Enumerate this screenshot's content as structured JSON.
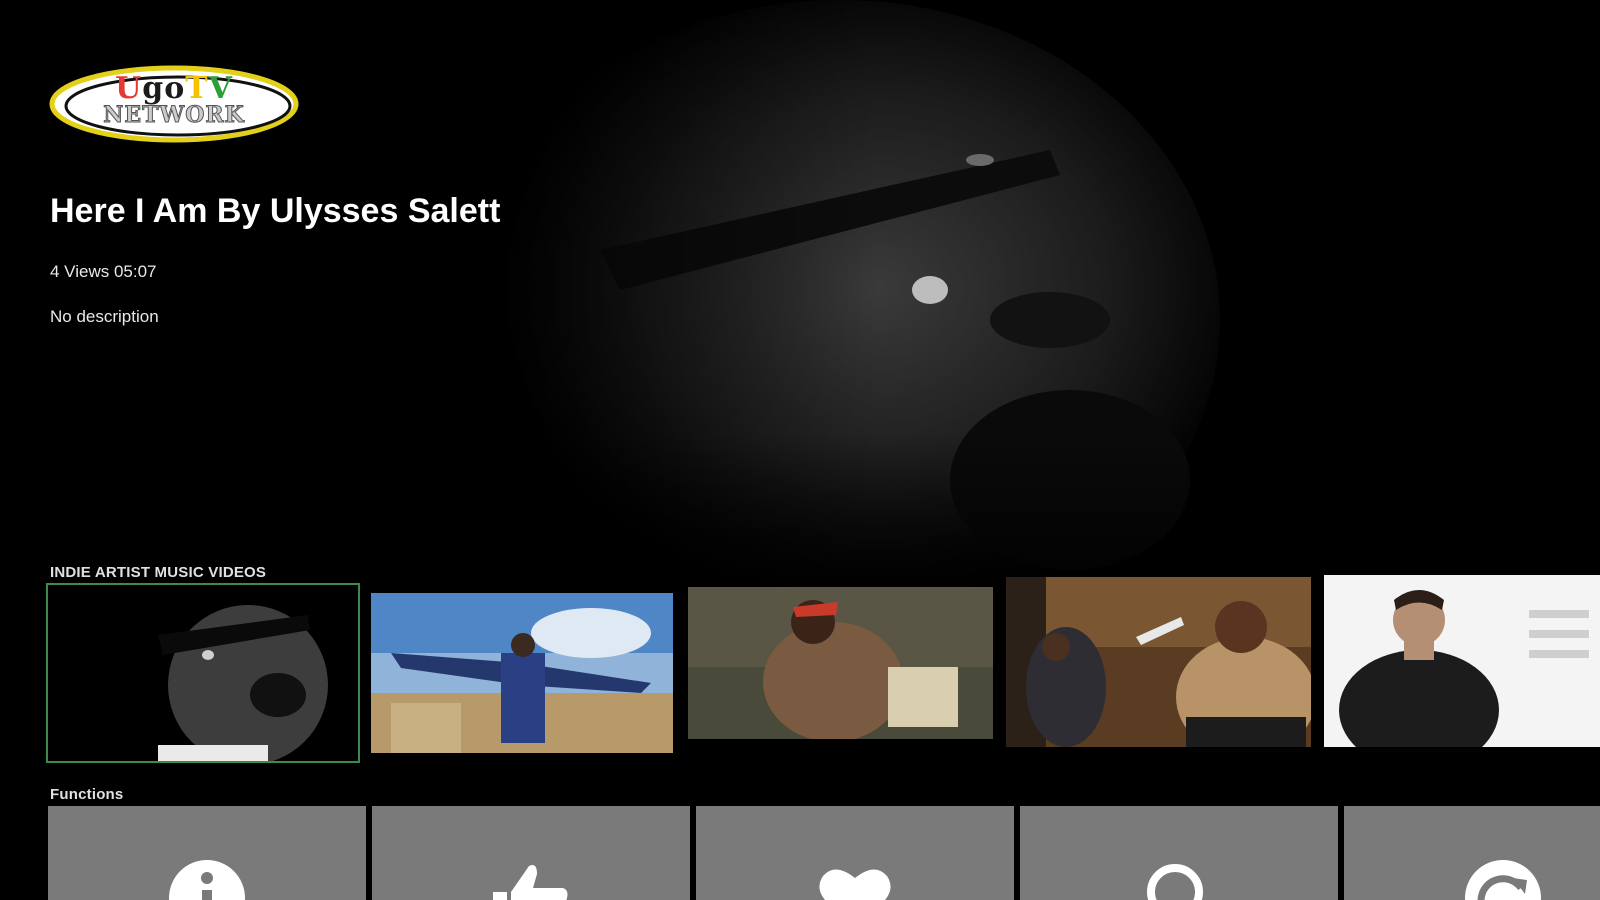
{
  "app": {
    "logo": {
      "letters": [
        {
          "char": "U",
          "color": "#e53935"
        },
        {
          "char": "g",
          "color": "#1b1b1b"
        },
        {
          "char": "o",
          "color": "#1b1b1b"
        },
        {
          "char": "T",
          "color": "#f6c200"
        },
        {
          "char": "V",
          "color": "#2e9e3a"
        }
      ],
      "subtitle": "NETWORK"
    }
  },
  "featured": {
    "title": "Here I Am By Ulysses Salett",
    "meta": "4 Views 05:07",
    "description": "No description"
  },
  "rows": {
    "videos_label": "INDIE ARTIST MUSIC VIDEOS",
    "functions_label": "Functions"
  },
  "functions": [
    {
      "name": "info-icon"
    },
    {
      "name": "thumbs-up-icon"
    },
    {
      "name": "heart-icon"
    },
    {
      "name": "search-icon"
    },
    {
      "name": "refresh-icon"
    }
  ],
  "colors": {
    "focus_border": "#3c8a4e",
    "tile_bg": "#7a7a7a"
  }
}
